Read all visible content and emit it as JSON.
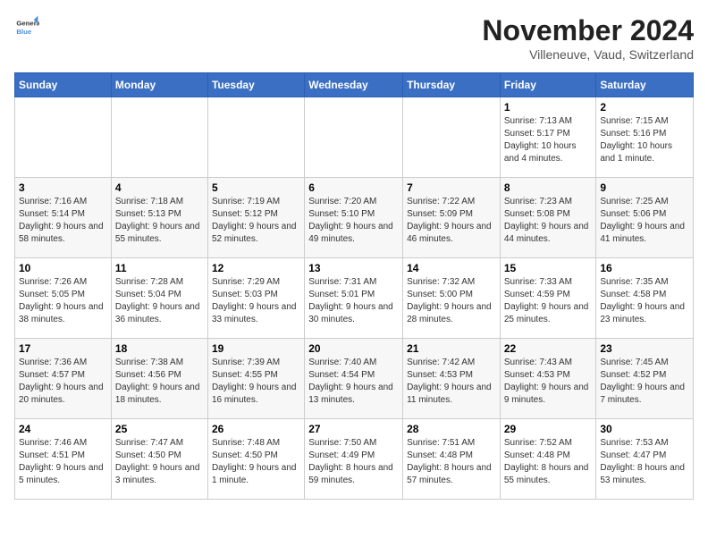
{
  "logo": {
    "line1": "General",
    "line2": "Blue"
  },
  "title": "November 2024",
  "location": "Villeneuve, Vaud, Switzerland",
  "weekdays": [
    "Sunday",
    "Monday",
    "Tuesday",
    "Wednesday",
    "Thursday",
    "Friday",
    "Saturday"
  ],
  "weeks": [
    [
      {
        "day": "",
        "info": ""
      },
      {
        "day": "",
        "info": ""
      },
      {
        "day": "",
        "info": ""
      },
      {
        "day": "",
        "info": ""
      },
      {
        "day": "",
        "info": ""
      },
      {
        "day": "1",
        "info": "Sunrise: 7:13 AM\nSunset: 5:17 PM\nDaylight: 10 hours and 4 minutes."
      },
      {
        "day": "2",
        "info": "Sunrise: 7:15 AM\nSunset: 5:16 PM\nDaylight: 10 hours and 1 minute."
      }
    ],
    [
      {
        "day": "3",
        "info": "Sunrise: 7:16 AM\nSunset: 5:14 PM\nDaylight: 9 hours and 58 minutes."
      },
      {
        "day": "4",
        "info": "Sunrise: 7:18 AM\nSunset: 5:13 PM\nDaylight: 9 hours and 55 minutes."
      },
      {
        "day": "5",
        "info": "Sunrise: 7:19 AM\nSunset: 5:12 PM\nDaylight: 9 hours and 52 minutes."
      },
      {
        "day": "6",
        "info": "Sunrise: 7:20 AM\nSunset: 5:10 PM\nDaylight: 9 hours and 49 minutes."
      },
      {
        "day": "7",
        "info": "Sunrise: 7:22 AM\nSunset: 5:09 PM\nDaylight: 9 hours and 46 minutes."
      },
      {
        "day": "8",
        "info": "Sunrise: 7:23 AM\nSunset: 5:08 PM\nDaylight: 9 hours and 44 minutes."
      },
      {
        "day": "9",
        "info": "Sunrise: 7:25 AM\nSunset: 5:06 PM\nDaylight: 9 hours and 41 minutes."
      }
    ],
    [
      {
        "day": "10",
        "info": "Sunrise: 7:26 AM\nSunset: 5:05 PM\nDaylight: 9 hours and 38 minutes."
      },
      {
        "day": "11",
        "info": "Sunrise: 7:28 AM\nSunset: 5:04 PM\nDaylight: 9 hours and 36 minutes."
      },
      {
        "day": "12",
        "info": "Sunrise: 7:29 AM\nSunset: 5:03 PM\nDaylight: 9 hours and 33 minutes."
      },
      {
        "day": "13",
        "info": "Sunrise: 7:31 AM\nSunset: 5:01 PM\nDaylight: 9 hours and 30 minutes."
      },
      {
        "day": "14",
        "info": "Sunrise: 7:32 AM\nSunset: 5:00 PM\nDaylight: 9 hours and 28 minutes."
      },
      {
        "day": "15",
        "info": "Sunrise: 7:33 AM\nSunset: 4:59 PM\nDaylight: 9 hours and 25 minutes."
      },
      {
        "day": "16",
        "info": "Sunrise: 7:35 AM\nSunset: 4:58 PM\nDaylight: 9 hours and 23 minutes."
      }
    ],
    [
      {
        "day": "17",
        "info": "Sunrise: 7:36 AM\nSunset: 4:57 PM\nDaylight: 9 hours and 20 minutes."
      },
      {
        "day": "18",
        "info": "Sunrise: 7:38 AM\nSunset: 4:56 PM\nDaylight: 9 hours and 18 minutes."
      },
      {
        "day": "19",
        "info": "Sunrise: 7:39 AM\nSunset: 4:55 PM\nDaylight: 9 hours and 16 minutes."
      },
      {
        "day": "20",
        "info": "Sunrise: 7:40 AM\nSunset: 4:54 PM\nDaylight: 9 hours and 13 minutes."
      },
      {
        "day": "21",
        "info": "Sunrise: 7:42 AM\nSunset: 4:53 PM\nDaylight: 9 hours and 11 minutes."
      },
      {
        "day": "22",
        "info": "Sunrise: 7:43 AM\nSunset: 4:53 PM\nDaylight: 9 hours and 9 minutes."
      },
      {
        "day": "23",
        "info": "Sunrise: 7:45 AM\nSunset: 4:52 PM\nDaylight: 9 hours and 7 minutes."
      }
    ],
    [
      {
        "day": "24",
        "info": "Sunrise: 7:46 AM\nSunset: 4:51 PM\nDaylight: 9 hours and 5 minutes."
      },
      {
        "day": "25",
        "info": "Sunrise: 7:47 AM\nSunset: 4:50 PM\nDaylight: 9 hours and 3 minutes."
      },
      {
        "day": "26",
        "info": "Sunrise: 7:48 AM\nSunset: 4:50 PM\nDaylight: 9 hours and 1 minute."
      },
      {
        "day": "27",
        "info": "Sunrise: 7:50 AM\nSunset: 4:49 PM\nDaylight: 8 hours and 59 minutes."
      },
      {
        "day": "28",
        "info": "Sunrise: 7:51 AM\nSunset: 4:48 PM\nDaylight: 8 hours and 57 minutes."
      },
      {
        "day": "29",
        "info": "Sunrise: 7:52 AM\nSunset: 4:48 PM\nDaylight: 8 hours and 55 minutes."
      },
      {
        "day": "30",
        "info": "Sunrise: 7:53 AM\nSunset: 4:47 PM\nDaylight: 8 hours and 53 minutes."
      }
    ]
  ]
}
